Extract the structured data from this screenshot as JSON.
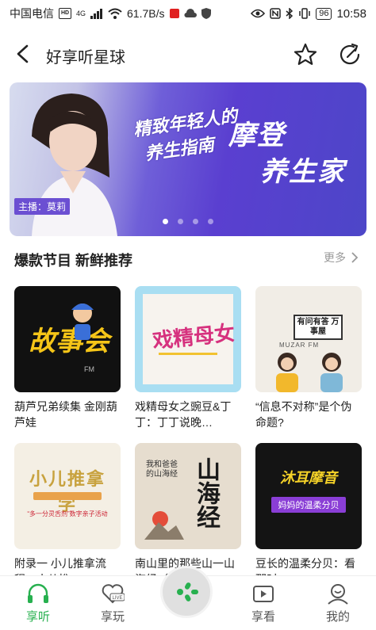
{
  "status_bar": {
    "carrier": "中国电信",
    "hd": "HD",
    "network": "4G",
    "speed": "61.7B/s",
    "battery": "96",
    "time": "10:58"
  },
  "header": {
    "title": "好享听星球"
  },
  "banner": {
    "slogan_line1": "精致年轻人的",
    "slogan_line2": "养生指南",
    "headline_line1": "摩登",
    "headline_line2": "养生家",
    "host": "主播：莫莉",
    "slide_count": 4,
    "active_slide": 0,
    "colors": {
      "start": "#d7dcef",
      "mid": "#5a3fd0",
      "end": "#4d46c8"
    }
  },
  "section": {
    "title": "爆款节目 新鲜推荐",
    "more_label": "更多"
  },
  "cards": [
    {
      "caption": "葫芦兄弟续集 金刚葫芦娃",
      "cover_text": "故事会",
      "cover_sub": "FM"
    },
    {
      "caption": "戏精母女之豌豆&丁丁：丁丁说晚…",
      "cover_text": "戏精母女",
      "cover_sub": ""
    },
    {
      "caption": "“信息不对称”是个伪命题?",
      "cover_text": "有问有答 万事屋",
      "cover_sub": "MUZAR FM"
    },
    {
      "caption": "附录一 小儿推拿流程：小儿推…",
      "cover_text": "小儿推拿学",
      "cover_sub": "“多一分灵舌剂”数字亲子活动"
    },
    {
      "caption": "南山里的那些山一山海经（二）",
      "cover_text": "山海经",
      "cover_sub": "我和爸爸的山海经"
    },
    {
      "caption": "豆长的温柔分贝：看那时…",
      "cover_text": "沐耳摩音",
      "cover_sub": "妈妈的温柔分贝"
    }
  ],
  "tabs": [
    {
      "label": "享听",
      "icon": "headphones-icon",
      "active": true
    },
    {
      "label": "享玩",
      "icon": "live-heart-icon",
      "active": false
    },
    {
      "label": "享看",
      "icon": "video-play-icon",
      "active": false
    },
    {
      "label": "我的",
      "icon": "profile-icon",
      "active": false
    }
  ],
  "accent_color": "#27b04f"
}
